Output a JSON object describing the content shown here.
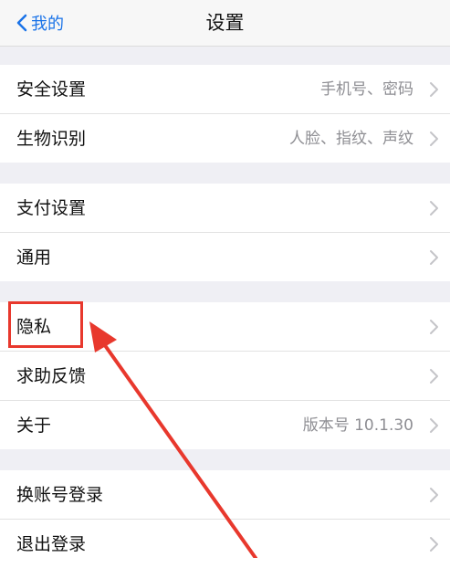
{
  "nav": {
    "back_label": "我的",
    "title": "设置"
  },
  "groups": [
    {
      "rows": [
        {
          "label": "安全设置",
          "value": "手机号、密码"
        },
        {
          "label": "生物识别",
          "value": "人脸、指纹、声纹"
        }
      ]
    },
    {
      "rows": [
        {
          "label": "支付设置",
          "value": ""
        },
        {
          "label": "通用",
          "value": ""
        }
      ]
    },
    {
      "rows": [
        {
          "label": "隐私",
          "value": ""
        },
        {
          "label": "求助反馈",
          "value": ""
        },
        {
          "label": "关于",
          "value": "版本号 10.1.30"
        }
      ]
    },
    {
      "rows": [
        {
          "label": "换账号登录",
          "value": ""
        },
        {
          "label": "退出登录",
          "value": ""
        }
      ]
    }
  ],
  "annotation": {
    "color": "#e8382d",
    "target": "隐私"
  },
  "colors": {
    "accent": "#1a73e8",
    "background": "#efeff4"
  }
}
